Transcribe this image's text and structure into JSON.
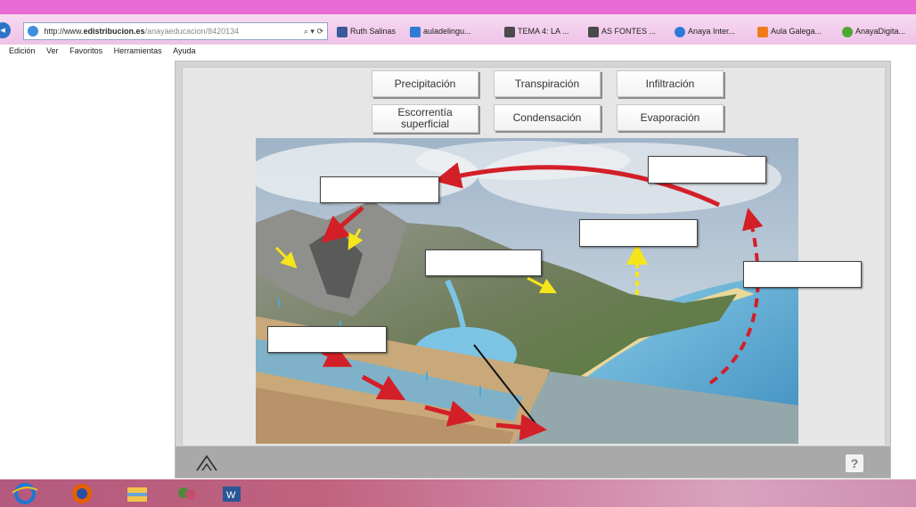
{
  "browser": {
    "url_prefix": "http://www.",
    "url_domain": "edistribucion.es",
    "url_path": "/anayaeducacion/8420134",
    "url_tools": "⌕ ▾ ⟳",
    "favorites": [
      {
        "label": "Ruth Salinas",
        "color": "#3b5998"
      },
      {
        "label": "auladelingu...",
        "color": "#2e7bd6"
      },
      {
        "label": "TEMA 4: LA ...",
        "color": "#4a4a4a"
      },
      {
        "label": "AS FONTES ...",
        "color": "#4a4a4a"
      },
      {
        "label": "Anaya Inter...",
        "color": "#2e7bd6"
      },
      {
        "label": "Aula Galega...",
        "color": "#f07b1a"
      },
      {
        "label": "AnayaDigita...",
        "color": "#4da832"
      }
    ],
    "menu": [
      "Edición",
      "Ver",
      "Favoritos",
      "Herramientas",
      "Ayuda"
    ]
  },
  "activity": {
    "terms": [
      "Precipitación",
      "Transpiración",
      "Infiltración",
      "Escorrentía superficial",
      "Condensación",
      "Evaporación"
    ],
    "help_label": "?"
  },
  "colors": {
    "sky": "#b9c9d9",
    "sea": "#5fa9cf",
    "arrow": "#d31f27",
    "yellow_arrow": "#f5e51b"
  },
  "taskbar": {
    "apps": [
      "internet-explorer",
      "firefox",
      "file-explorer",
      "photos",
      "word"
    ],
    "word_label": "W"
  }
}
